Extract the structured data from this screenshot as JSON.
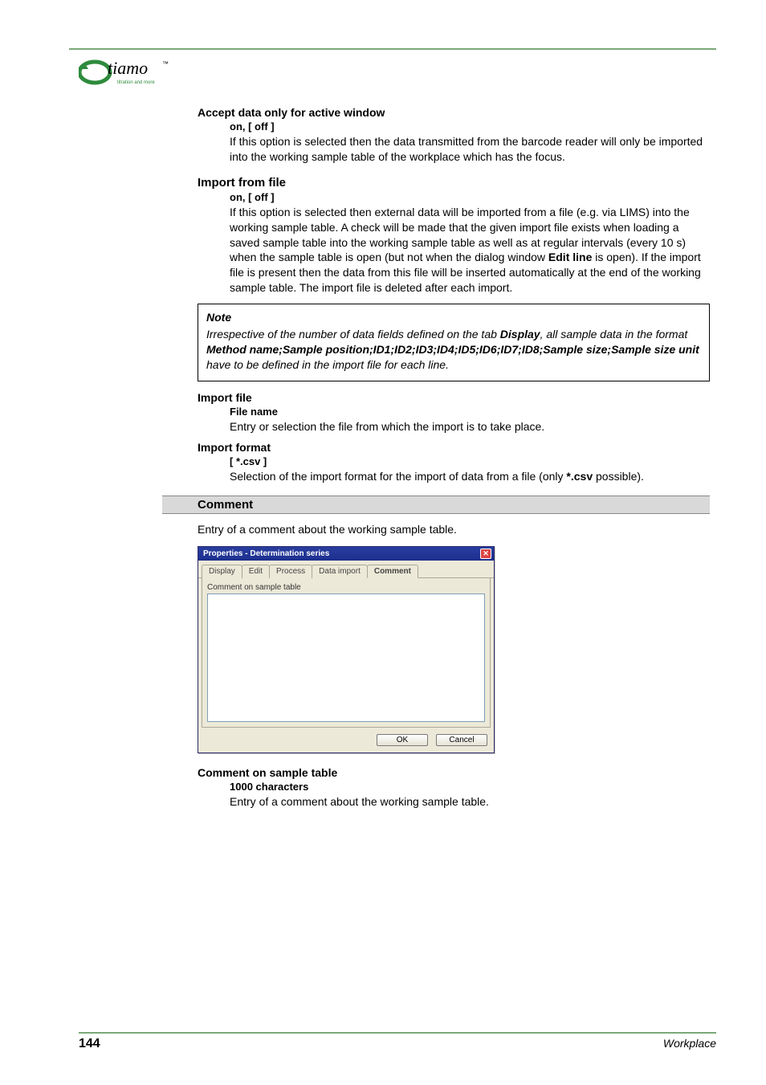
{
  "logo_text": "tiamo",
  "logo_subtext": "titration and more",
  "sections": {
    "accept": {
      "title": "Accept data only for active window",
      "option": "on, [ off ]",
      "text": "If this option is selected then the data transmitted from the barcode reader will only be imported into the working sample table of the workplace which has the focus."
    },
    "import_from_file": {
      "heading": "Import from file",
      "option": "on, [ off ]",
      "text_a": "If this option is selected then external data will be imported from a file (e.g. via LIMS) into the working sample table. A check will be made that the given import file exists when loading a saved sample table into the working sample table as well as at regular intervals (every 10 s) when the sample table is open (but not when the dialog window ",
      "edit_line": "Edit line",
      "text_b": " is open). If the import file is present then the data from this file will be inserted automatically at the end of the working sample table. The import file is deleted after each import."
    },
    "note": {
      "title": "Note",
      "p1a": "Irrespective of the number of data fields defined on the tab ",
      "display_word": "Display",
      "p1b": ", all sample data in the format ",
      "method": "Method name;Sample position;ID1;ID2;ID3;ID4;ID5;ID6;ID7;ID8;Sample size;Sample size unit",
      "p1c": " have to be defined in the import file for each line."
    },
    "import_file": {
      "title": "Import file",
      "sub": "File name",
      "text": "Entry or selection the file from which the import is to take place."
    },
    "import_format": {
      "title": "Import format",
      "sub": "[ *.csv ]",
      "text_a": "Selection of the import format for the import of data from a file (only ",
      "csv": "*.csv",
      "text_b": " possible)."
    },
    "comment": {
      "heading": "Comment",
      "intro": "Entry of a comment about the working sample table.",
      "sub_title": "Comment on sample table",
      "sub_val": "1000 characters",
      "sub_text": "Entry of a comment about the working sample table."
    }
  },
  "dialog": {
    "title": "Properties - Determination series",
    "tabs": [
      "Display",
      "Edit",
      "Process",
      "Data import",
      "Comment"
    ],
    "active_tab": 4,
    "body_label": "Comment on sample table",
    "ok": "OK",
    "cancel": "Cancel"
  },
  "footer": {
    "page": "144",
    "right": "Workplace"
  }
}
